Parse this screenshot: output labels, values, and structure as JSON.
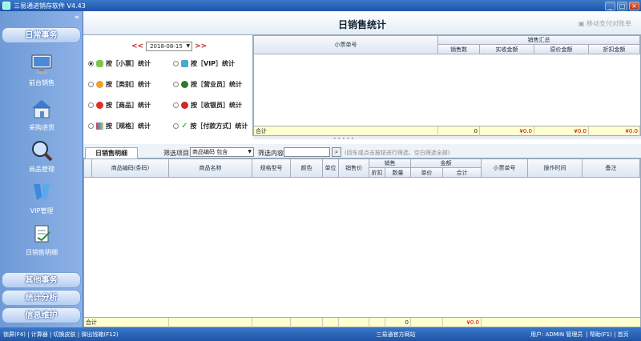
{
  "window": {
    "title": "三易通进销存软件 V4.43",
    "min": "_",
    "max": "□",
    "close": "×"
  },
  "sidebar": {
    "collapse": "«",
    "group1": "日常事务",
    "items": [
      {
        "label": "前台销售",
        "icon": "monitor-icon"
      },
      {
        "label": "采购进货",
        "icon": "house-icon"
      },
      {
        "label": "商品管理",
        "icon": "magnifier-icon"
      },
      {
        "label": "VIP管理",
        "icon": "vip-ribbon-icon"
      },
      {
        "label": "日销售明细",
        "icon": "report-icon"
      }
    ],
    "group2": "其他事务",
    "group3": "统计分析",
    "group4": "信息维护"
  },
  "page": {
    "title": "日销售统计",
    "mobile_pay": "移动支付对账单"
  },
  "stats": {
    "date": "2018-08-15",
    "prev": "<<",
    "next": ">>",
    "options": [
      {
        "label": "按［小票］统计",
        "selected": true
      },
      {
        "label": "按［VIP］统计",
        "selected": false
      },
      {
        "label": "按［类别］统计",
        "selected": false
      },
      {
        "label": "按［营业员］统计",
        "selected": false
      },
      {
        "label": "按［商品］统计",
        "selected": false
      },
      {
        "label": "按［收银员］统计",
        "selected": false
      },
      {
        "label": "按［规格］统计",
        "selected": false
      },
      {
        "label": "按［付款方式］统计",
        "selected": false
      }
    ]
  },
  "summary_table": {
    "col_ticket": "小票单号",
    "group": "销售汇总",
    "cols": [
      "销售数",
      "实收金额",
      "原价金额",
      "折扣金额"
    ],
    "total_label": "合计",
    "totals": [
      "0",
      "¥0.0",
      "¥0.0",
      "¥0.0"
    ]
  },
  "detail": {
    "tab": "日销售明细",
    "filter_label": "筛选项目:",
    "filter_value": "商品编码 包含",
    "content_label": "筛选内容:",
    "content_value": "",
    "tip": "(回车或点击按钮进行筛选，空白筛选全部)",
    "cols": {
      "code": "商品编码(条码)",
      "name": "商品名称",
      "spec": "规格型号",
      "color": "颜色",
      "unit": "单位",
      "price": "销售价",
      "sale": "销售",
      "discount": "折扣",
      "qty": "数量",
      "amount": "金额",
      "unit_price": "单价",
      "total": "合计",
      "ticket": "小票单号",
      "time": "操作时间",
      "note": "备注"
    },
    "total_label": "合计",
    "total_qty": "0",
    "total_amount": "¥0.0"
  },
  "status": {
    "left": "锁屏(F4) | 计算器 | 切换皮肤 | 弹出钱箱(F12)",
    "center": "三易通官方网站",
    "user": "用户: ADMIN 管理员",
    "right": "| 帮助(F1) | 首页"
  }
}
